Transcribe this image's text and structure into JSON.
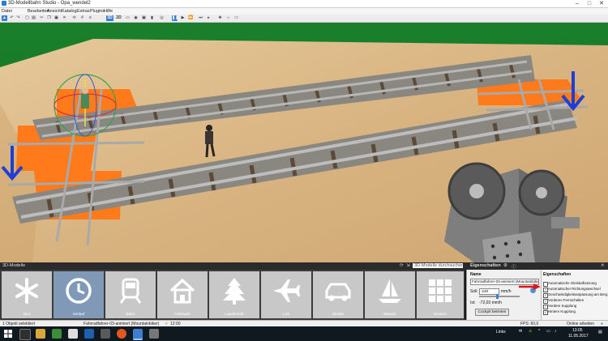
{
  "window": {
    "title": "3D-Modellbahn Studio - Opa_wendel2"
  },
  "menu": [
    "Datei",
    "Bearbeiten",
    "Ansicht",
    "Katalog",
    "Extras",
    "Plugins",
    "Hilfe"
  ],
  "toolbar": {
    "view_3d": "3D",
    "view_2d": "2D"
  },
  "bottom_tabs": {
    "models": "3D-Modelle",
    "search_placeholder": "3D-Modelle durchsuchen...",
    "properties": "Eigenschaften"
  },
  "categories": [
    {
      "label": "Neu",
      "icon": "asterisk-icon"
    },
    {
      "label": "Verlauf",
      "icon": "clock-icon"
    },
    {
      "label": "Bahn",
      "icon": "train-icon"
    },
    {
      "label": "Gebäude",
      "icon": "house-icon"
    },
    {
      "label": "Landschaft",
      "icon": "tree-icon"
    },
    {
      "label": "Luft",
      "icon": "airplane-icon"
    },
    {
      "label": "Straße",
      "icon": "car-icon"
    },
    {
      "label": "Wasser",
      "icon": "sailboat-icon"
    },
    {
      "label": "Module",
      "icon": "grid-icon"
    }
  ],
  "properties": {
    "name_label": "Name",
    "name_value": "Fahrradfahrer-03-animiert (Mountainbiker)",
    "soll_label": "Soll:",
    "soll_value": "-240",
    "soll_unit": "mm/h",
    "ist_label": "Ist:",
    "ist_value": "-72,03 mm/h",
    "cockpit_button": "Cockpit betreten"
  },
  "eigenschaften": {
    "heading": "Eigenschaften",
    "options": [
      {
        "label": "Automatische Gleiskollisierung",
        "checked": false
      },
      {
        "label": "Automatischer Richtungswechsel",
        "checked": true
      },
      {
        "label": "Geschwindigkeitsanpassung am Berg",
        "checked": true
      },
      {
        "label": "Vorderes Fernschalten",
        "checked": true
      },
      {
        "label": "Vordere Kupplung",
        "checked": true
      },
      {
        "label": "Hintere Kupplung",
        "checked": true
      }
    ]
  },
  "status": {
    "selection": "1 Objekt selektiert",
    "object": "Fahrradfahrer-03-animiert (Mountainbiker)",
    "time": "12:00",
    "fps": "FPS: 60,0",
    "online": "Online arbeiten"
  },
  "taskbar": {
    "links": "Links",
    "clock_time": "13:05",
    "clock_date": "11.05.2017"
  },
  "colors": {
    "accent": "#3b7fd0",
    "ground": "#d9b98a",
    "marker": "#ff7a1a",
    "arrow": "#1f3fd4"
  }
}
